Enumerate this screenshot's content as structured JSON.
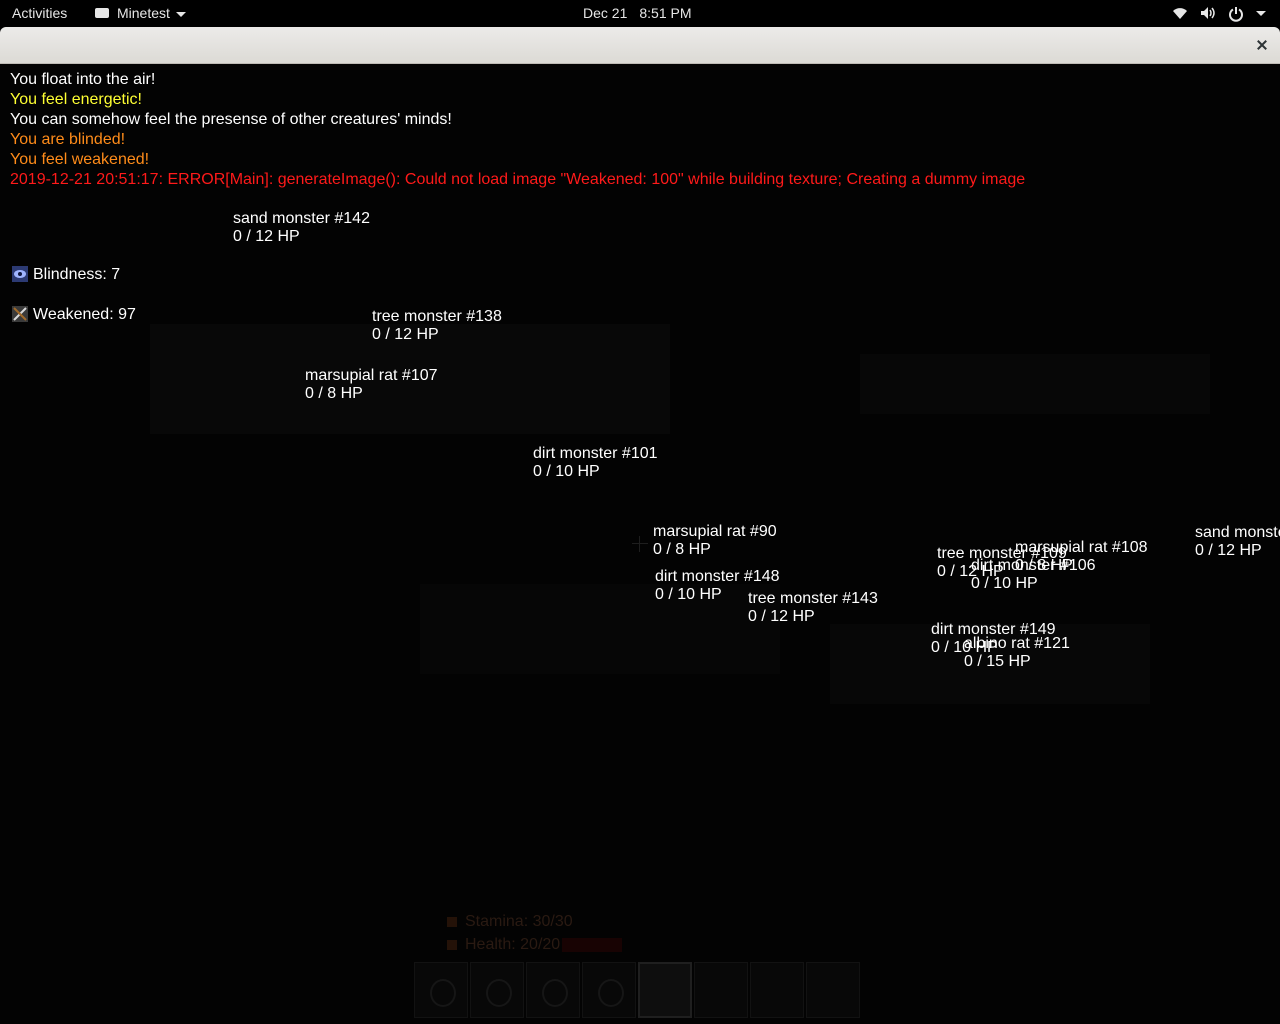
{
  "topbar": {
    "activities": "Activities",
    "app_name": "Minetest",
    "clock_date": "Dec 21",
    "clock_time": "8:51 PM",
    "icons": [
      "wifi-icon",
      "volume-icon",
      "power-icon"
    ]
  },
  "window": {
    "close_icon": "close-icon"
  },
  "chat": [
    {
      "text": "You float into the air!",
      "color": "#ffffff"
    },
    {
      "text": "You feel energetic!",
      "color": "#ffff33"
    },
    {
      "text": "You can somehow feel the presense of other creatures' minds!",
      "color": "#ffffff"
    },
    {
      "text": "You are blinded!",
      "color": "#ff8c1a"
    },
    {
      "text": "You feel weakened!",
      "color": "#ff8c1a"
    },
    {
      "text": "2019-12-21 20:51:17: ERROR[Main]: generateImage(): Could not load image \"Weakened: 100\" while building texture; Creating a dummy image",
      "color": "#ff1a1a"
    }
  ],
  "effects": [
    {
      "icon": "eye-icon",
      "label": "Blindness: 7"
    },
    {
      "icon": "broken-sword-icon",
      "label": "Weakened: 97"
    }
  ],
  "nametags": [
    {
      "name": "sand monster #142",
      "hp": "0 / 12 HP"
    },
    {
      "name": "tree monster #138",
      "hp": "0 / 12 HP"
    },
    {
      "name": "marsupial rat #107",
      "hp": "0 / 8 HP"
    },
    {
      "name": "dirt monster #101",
      "hp": "0 / 10 HP"
    },
    {
      "name": "marsupial rat #90",
      "hp": "0 / 8 HP"
    },
    {
      "name": "dirt monster #148",
      "hp": "0 / 10 HP"
    },
    {
      "name": "tree monster #143",
      "hp": "0 / 12 HP"
    },
    {
      "name": "tree monster #109",
      "hp": "0 / 12 HP"
    },
    {
      "name": "marsupial rat #108",
      "hp": "0 / 8 HP"
    },
    {
      "name": "dirt monster #106",
      "hp": "0 / 10 HP"
    },
    {
      "name": "sand monster",
      "hp": "0 / 12 HP"
    },
    {
      "name": "dirt monster #149",
      "hp": "0 / 10 HP"
    },
    {
      "name": "albino rat #121",
      "hp": "0 / 15 HP"
    }
  ],
  "hud": {
    "stamina_label": "Stamina: 30/30",
    "health_label": "Health: 20/20",
    "stamina_fraction": 1.0,
    "health_fraction": 1.0,
    "hotbar_slots": 8,
    "selected_slot": 4
  }
}
